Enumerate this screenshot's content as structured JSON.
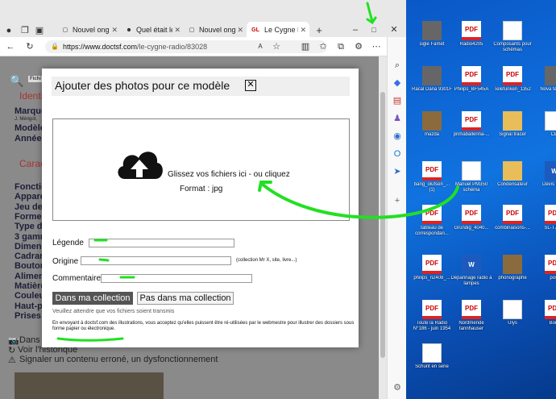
{
  "browser": {
    "tabs": [
      {
        "label": "Nouvel onglet",
        "active": false
      },
      {
        "label": "Quel était le p",
        "active": false
      },
      {
        "label": "Nouvel onglet",
        "active": false
      },
      {
        "label": "Le Cygne Radio",
        "favicon": "GL",
        "active": true
      }
    ],
    "url_host": "https://www.doctsf.com",
    "url_path": "/le-cygne-radio/83028",
    "new_tab": "+"
  },
  "page": {
    "filter_button": "Fichi",
    "identity_heading": "Identi",
    "identity_lines": [
      "Marque",
      "J. Mérigot,",
      "Modèle",
      "Année"
    ],
    "characteristics_heading": "Carac",
    "characteristics_lines": [
      "Fonctio",
      "Appare",
      "Jeu de",
      "Forme",
      "Type de",
      "3 gamm",
      "Dimens",
      "Cadran",
      "Bouton",
      "Alimen",
      "Matière",
      "Couleu",
      "Haut-pa",
      "Prises"
    ],
    "footer_dans": "Dans",
    "footer_history": "Voir l'historique",
    "footer_report": "Signaler un contenu erroné, un dysfonctionnement"
  },
  "modal": {
    "title": "Ajouter des photos pour ce modèle",
    "close": "✕",
    "drop_text": "Glissez vos fichiers ici - ou cliquez",
    "format": "Format : jpg",
    "legende_label": "Légende",
    "origine_label": "Origine",
    "origine_hint": "(collection Mr X, site, livre...)",
    "commentaire_label": "Commentaire",
    "button_in": "Dans ma collection",
    "button_out": "Pas dans ma collection",
    "wait": "Veuillez attendre que vos fichiers soient transmis",
    "legal": "En envoyant à doctsf.com des illustrations, vous acceptez qu'elles puissent être ré-utilisées par le webmestre pour illustrer des dossiers sous forme papier ou électronique."
  },
  "desktop": {
    "icons": [
      {
        "label": "sigle Famet",
        "kind": "photo"
      },
      {
        "label": "Radio4205",
        "kind": "pdf"
      },
      {
        "label": "Composants pour schémas",
        "kind": "doc"
      },
      {
        "label": "Racal Dana 9301F",
        "kind": "photo"
      },
      {
        "label": "Philips_BF545A",
        "kind": "pdf"
      },
      {
        "label": "Telefunken_1352",
        "kind": "pdf"
      },
      {
        "label": "Nova te déco",
        "kind": "photo"
      },
      {
        "label": "mazda",
        "kind": "brown"
      },
      {
        "label": "primaballerina-...",
        "kind": "pdf"
      },
      {
        "label": "Signal tracer",
        "kind": "folder"
      },
      {
        "label": "Cla",
        "kind": "doc"
      },
      {
        "label": "bang_olufsen_... (1)",
        "kind": "pdf"
      },
      {
        "label": "Manuel PM350 schéma",
        "kind": "doc"
      },
      {
        "label": "Condensateur",
        "kind": "folder"
      },
      {
        "label": "Devis 1902",
        "kind": "word"
      },
      {
        "label": "tableau de correspondan...",
        "kind": "pdf"
      },
      {
        "label": "Grundig_4040...",
        "kind": "pdf"
      },
      {
        "label": "combinaisons-...",
        "kind": "pdf"
      },
      {
        "label": "SL-T7MB",
        "kind": "pdf"
      },
      {
        "label": "philips_n2408_...",
        "kind": "pdf"
      },
      {
        "label": "Dépannage radio à lampes",
        "kind": "word"
      },
      {
        "label": "phonographe",
        "kind": "brown"
      },
      {
        "label": "post",
        "kind": "pdf"
      },
      {
        "label": "Toute la Radio N°186 - juin 1954",
        "kind": "pdf"
      },
      {
        "label": "Nordmende tannhauser",
        "kind": "pdf"
      },
      {
        "label": "Ulys",
        "kind": "doc"
      },
      {
        "label": "Bour",
        "kind": "pdf"
      },
      {
        "label": "Schunt en serie",
        "kind": "doc"
      }
    ],
    "pdf_badge": "PDF",
    "word_badge": "W"
  }
}
